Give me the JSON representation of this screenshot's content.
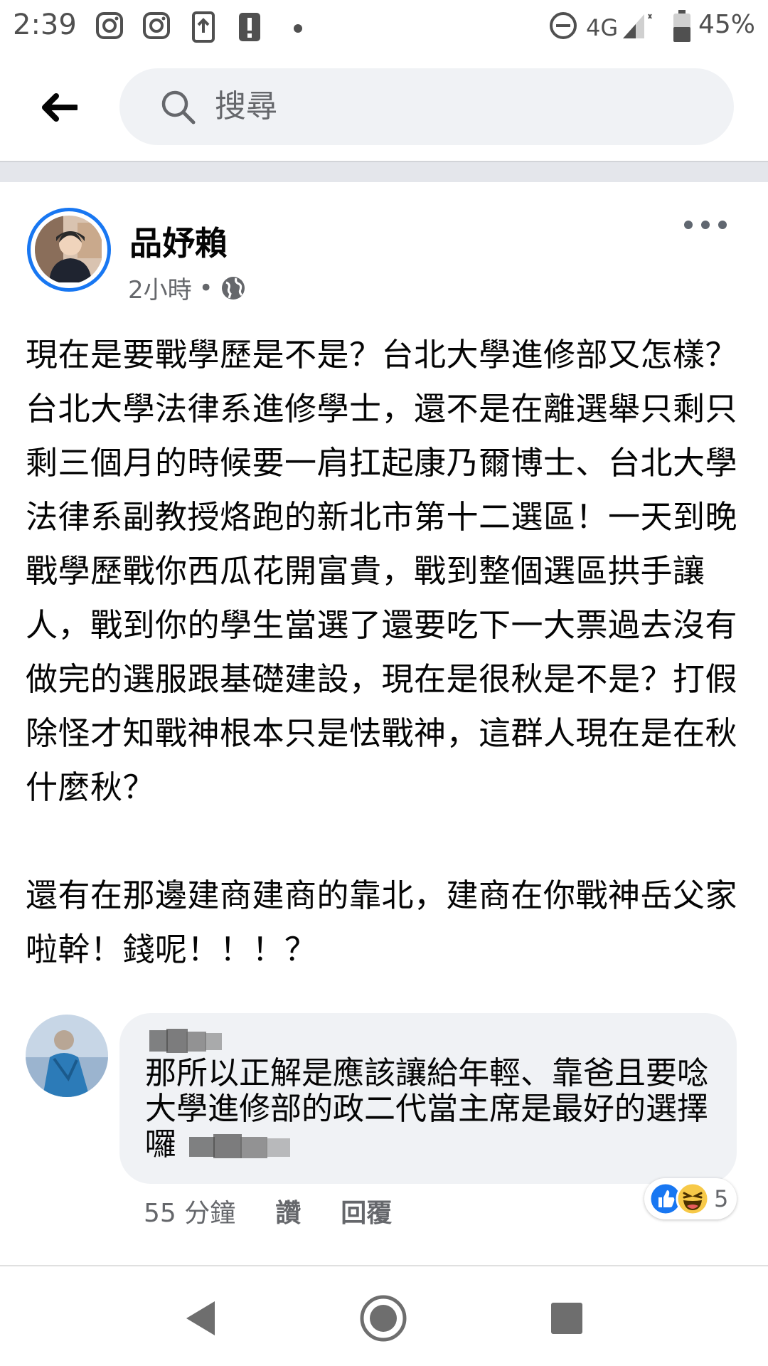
{
  "status_bar": {
    "time": "2:39",
    "network": "4G",
    "battery": "45%"
  },
  "header": {
    "search_placeholder": "搜尋"
  },
  "post": {
    "author": "品妤賴",
    "time": "2小時",
    "separator": "•",
    "body": "現在是要戰學歷是不是？台北大學進修部又怎樣？台北大學法律系進修學士，還不是在離選舉只剩只剩三個月的時候要一肩扛起康乃爾博士、台北大學法律系副教授烙跑的新北市第十二選區！一天到晚戰學歷戰你西瓜花開富貴，戰到整個選區拱手讓人，戰到你的學生當選了還要吃下一大票過去沒有做完的選服跟基礎建設，現在是很秋是不是？打假除怪才知戰神根本只是怯戰神，這群人現在是在秋什麼秋？\n\n還有在那邊建商建商的靠北，建商在你戰神岳父家啦幹！錢呢！！！？"
  },
  "comment": {
    "text": "那所以正解是應該讓給年輕、靠爸且要唸大學進修部的政二代當主席是最好的選擇囉",
    "time": "55 分鐘",
    "like_label": "讚",
    "reply_label": "回覆",
    "reaction_count": "5"
  },
  "colors": {
    "accent": "#1877f2",
    "bubble": "#f0f2f5",
    "secondary_text": "#65676b"
  }
}
